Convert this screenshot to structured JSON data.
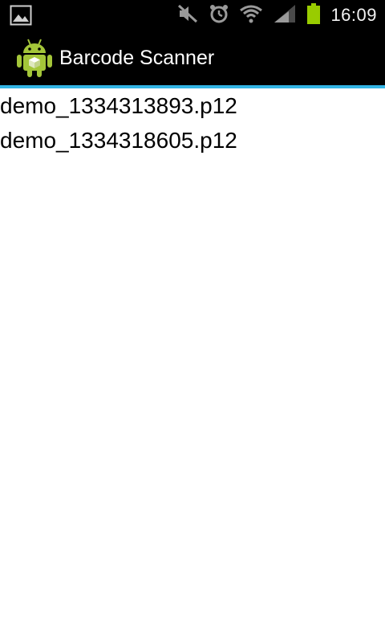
{
  "status_bar": {
    "time": "16:09",
    "icons": [
      "gallery-notification-icon",
      "mute-icon",
      "alarm-icon",
      "wifi-icon",
      "signal-icon",
      "battery-icon"
    ],
    "battery_color": "#99cc00"
  },
  "app_bar": {
    "title": "Barcode Scanner",
    "logo_icon": "android-robot-icon",
    "accent_color": "#33b5e5"
  },
  "files": [
    {
      "name": "demo_1334313893.p12"
    },
    {
      "name": "demo_1334318605.p12"
    }
  ]
}
